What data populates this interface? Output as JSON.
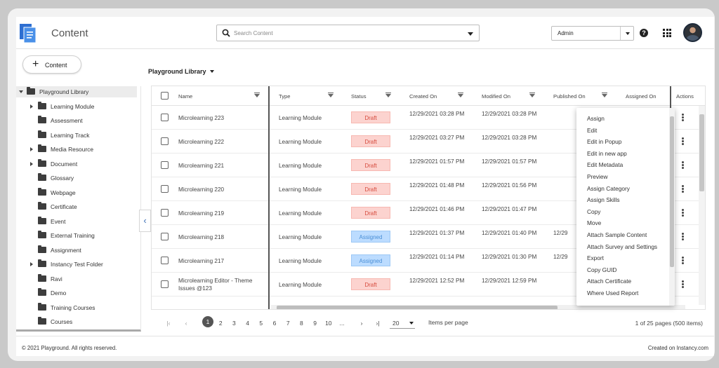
{
  "header": {
    "title": "Content",
    "search_placeholder": "Search Content",
    "role": "Admin",
    "help_symbol": "?"
  },
  "sidebar": {
    "add_button_label": "Content",
    "add_symbol": "+",
    "collapse_symbol": "‹",
    "tree": [
      {
        "label": "Playground Library",
        "level": 0,
        "expander": "down",
        "selected": true
      },
      {
        "label": "Learning Module",
        "level": 1,
        "expander": "right"
      },
      {
        "label": "Assessment",
        "level": 1,
        "expander": "none"
      },
      {
        "label": "Learning Track",
        "level": 1,
        "expander": "none"
      },
      {
        "label": "Media Resource",
        "level": 1,
        "expander": "right"
      },
      {
        "label": "Document",
        "level": 1,
        "expander": "right"
      },
      {
        "label": "Glossary",
        "level": 1,
        "expander": "none"
      },
      {
        "label": "Webpage",
        "level": 1,
        "expander": "none"
      },
      {
        "label": "Certificate",
        "level": 1,
        "expander": "none"
      },
      {
        "label": "Event",
        "level": 1,
        "expander": "none"
      },
      {
        "label": "External Training",
        "level": 1,
        "expander": "none"
      },
      {
        "label": "Assignment",
        "level": 1,
        "expander": "none"
      },
      {
        "label": "Instancy Test Folder",
        "level": 1,
        "expander": "right"
      },
      {
        "label": "Ravi",
        "level": 1,
        "expander": "none"
      },
      {
        "label": "Demo",
        "level": 1,
        "expander": "none"
      },
      {
        "label": "Training Courses",
        "level": 1,
        "expander": "none"
      },
      {
        "label": "Courses",
        "level": 1,
        "expander": "none"
      }
    ]
  },
  "library": {
    "label": "Playground Library"
  },
  "table": {
    "columns": {
      "name": "Name",
      "type": "Type",
      "status": "Status",
      "created": "Created On",
      "modified": "Modified On",
      "published": "Published On",
      "assigned": "Assigned On",
      "actions": "Actions"
    },
    "rows": [
      {
        "name": "Microlearning 223",
        "type": "Learning Module",
        "status": "Draft",
        "created": "12/29/2021 03:28 PM",
        "modified": "12/29/2021 03:28 PM",
        "published": ""
      },
      {
        "name": "Microlearning 222",
        "type": "Learning Module",
        "status": "Draft",
        "created": "12/29/2021 03:27 PM",
        "modified": "12/29/2021 03:28 PM",
        "published": ""
      },
      {
        "name": "Microlearning 221",
        "type": "Learning Module",
        "status": "Draft",
        "created": "12/29/2021 01:57 PM",
        "modified": "12/29/2021 01:57 PM",
        "published": ""
      },
      {
        "name": "Microlearning 220",
        "type": "Learning Module",
        "status": "Draft",
        "created": "12/29/2021 01:48 PM",
        "modified": "12/29/2021 01:56 PM",
        "published": ""
      },
      {
        "name": "Microlearning 219",
        "type": "Learning Module",
        "status": "Draft",
        "created": "12/29/2021 01:46 PM",
        "modified": "12/29/2021 01:47 PM",
        "published": ""
      },
      {
        "name": "Microlearning 218",
        "type": "Learning Module",
        "status": "Assigned",
        "created": "12/29/2021 01:37 PM",
        "modified": "12/29/2021 01:40 PM",
        "published": "12/29"
      },
      {
        "name": "Microlearning 217",
        "type": "Learning Module",
        "status": "Assigned",
        "created": "12/29/2021 01:14 PM",
        "modified": "12/29/2021 01:30 PM",
        "published": "12/29"
      },
      {
        "name": "Microlearning Editor - Theme Issues @123",
        "type": "Learning Module",
        "status": "Draft",
        "created": "12/29/2021 12:52 PM",
        "modified": "12/29/2021 12:59 PM",
        "published": ""
      }
    ]
  },
  "context_menu": {
    "items": [
      "Assign",
      "Edit",
      "Edit in Popup",
      "Edit in new app",
      "Edit Metadata",
      "Preview",
      "Assign Category",
      "Assign Skills",
      "Copy",
      "Move",
      "Attach Sample Content",
      "Attach Survey and Settings",
      "Export",
      "Copy GUID",
      "Attach Certificate",
      "Where Used Report"
    ]
  },
  "pagination": {
    "first": "|‹",
    "prev": "‹",
    "pages": [
      "1",
      "2",
      "3",
      "4",
      "5",
      "6",
      "7",
      "8",
      "9",
      "10",
      "..."
    ],
    "current_page": "1",
    "next": "›",
    "last": "›|",
    "items_per_page": "20",
    "items_per_page_label": "Items per page",
    "page_info": "1 of 25 pages (500 items)"
  },
  "footer": {
    "copyright": "© 2021 Playground. All rights reserved.",
    "credit": "Created on Instancy.com"
  },
  "colors": {
    "draft_bg": "#fcd3cf",
    "draft_text": "#d64c3f",
    "assigned_bg": "#bcdcff",
    "assigned_text": "#4a8fd6",
    "logo_blue": "#2e6fd1"
  }
}
